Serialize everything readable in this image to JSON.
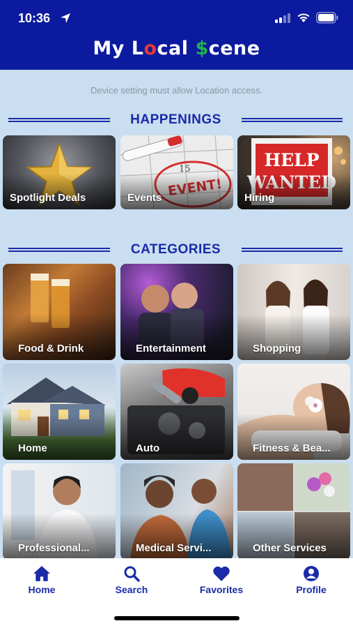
{
  "status_bar": {
    "time": "10:36"
  },
  "header": {
    "logo_parts": [
      "My L",
      "o",
      "cal ",
      "$",
      "cene"
    ],
    "brand_color": "#0b1a9e"
  },
  "notice": "Device setting must allow Location access.",
  "happenings": {
    "title": "HAPPENINGS",
    "items": [
      {
        "label": "Spotlight Deals"
      },
      {
        "label": "Events"
      },
      {
        "label": "Hiring"
      }
    ]
  },
  "categories": {
    "title": "CATEGORIES",
    "items": [
      {
        "label": "Food & Drink"
      },
      {
        "label": "Entertainment"
      },
      {
        "label": "Shopping"
      },
      {
        "label": "Home"
      },
      {
        "label": "Auto"
      },
      {
        "label": "Fitness & Bea..."
      },
      {
        "label": "Professional..."
      },
      {
        "label": "Medical Servi..."
      },
      {
        "label": "Other Services"
      }
    ]
  },
  "tabs": [
    {
      "label": "Home",
      "icon": "home-icon"
    },
    {
      "label": "Search",
      "icon": "search-icon"
    },
    {
      "label": "Favorites",
      "icon": "heart-icon"
    },
    {
      "label": "Profile",
      "icon": "profile-icon"
    }
  ],
  "colors": {
    "accent": "#1a2aa8",
    "background": "#c9def0",
    "pin": "#e53935",
    "dollar": "#22b24c"
  }
}
